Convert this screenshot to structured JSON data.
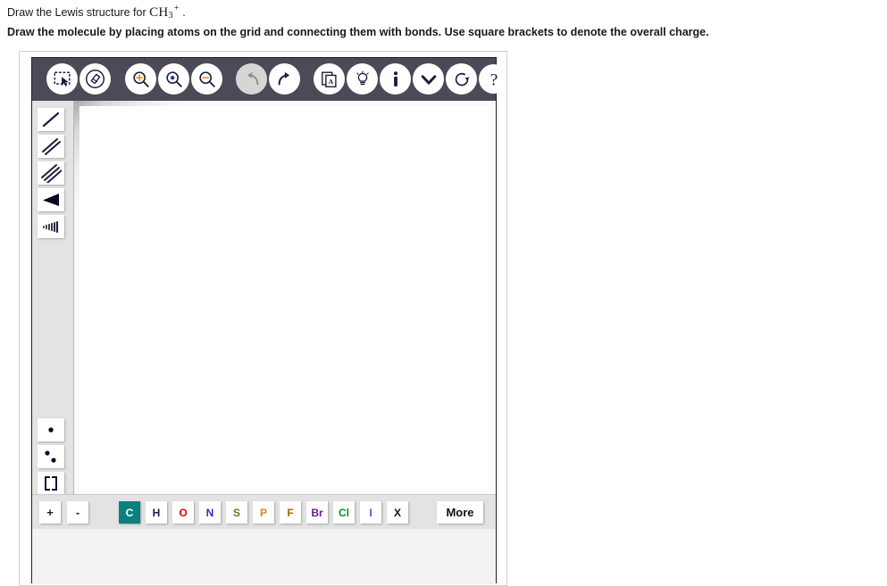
{
  "prompt": {
    "line1_prefix": "Draw the Lewis structure for ",
    "formula_element": "CH",
    "formula_sub": "3",
    "formula_sup": "+",
    "line1_suffix": " .",
    "line2": "Draw the molecule by placing atoms on the grid and connecting them with bonds. Use square brackets to denote the overall charge."
  },
  "toolbar": {
    "buttons": [
      {
        "name": "select-lasso-icon",
        "label": "Select",
        "disabled": false
      },
      {
        "name": "eraser-icon",
        "label": "Erase",
        "disabled": false
      },
      {
        "name": "zoom-in-icon",
        "label": "Zoom In",
        "disabled": false
      },
      {
        "name": "zoom-fit-icon",
        "label": "Zoom To Fit",
        "disabled": false
      },
      {
        "name": "zoom-out-icon",
        "label": "Zoom Out",
        "disabled": false
      },
      {
        "name": "undo-icon",
        "label": "Undo",
        "disabled": true
      },
      {
        "name": "redo-icon",
        "label": "Redo",
        "disabled": false
      },
      {
        "name": "copy-to-text-icon",
        "label": "Copy",
        "disabled": false
      },
      {
        "name": "lightbulb-icon",
        "label": "Hint",
        "disabled": false
      },
      {
        "name": "info-icon",
        "label": "Information",
        "disabled": false
      },
      {
        "name": "chevron-down-icon",
        "label": "More Options",
        "disabled": false
      },
      {
        "name": "reset-icon",
        "label": "Reset",
        "disabled": false
      },
      {
        "name": "help-icon",
        "label": "Help",
        "disabled": false
      }
    ]
  },
  "tools": {
    "bonds": [
      {
        "name": "single-bond-icon",
        "label": "Single Bond"
      },
      {
        "name": "double-bond-icon",
        "label": "Double Bond"
      },
      {
        "name": "triple-bond-icon",
        "label": "Triple Bond"
      },
      {
        "name": "wedge-bond-icon",
        "label": "Wedge Bond"
      },
      {
        "name": "hashed-bond-icon",
        "label": "Hashed Bond"
      }
    ],
    "electrons": [
      {
        "name": "single-electron-icon",
        "label": "Single Electron"
      },
      {
        "name": "lone-pair-icon",
        "label": "Lone Pair"
      },
      {
        "name": "brackets-icon",
        "label": "Brackets"
      }
    ]
  },
  "palette": {
    "charges": [
      {
        "label": "+",
        "name": "increase-charge-button"
      },
      {
        "label": "-",
        "name": "decrease-charge-button"
      }
    ],
    "elements": [
      {
        "symbol": "C",
        "color": "#ffffff",
        "selected": true
      },
      {
        "symbol": "H",
        "color": "#1a1a4e",
        "selected": false
      },
      {
        "symbol": "O",
        "color": "#e00000",
        "selected": false
      },
      {
        "symbol": "N",
        "color": "#4b1fc8",
        "selected": false
      },
      {
        "symbol": "S",
        "color": "#7a7016",
        "selected": false
      },
      {
        "symbol": "P",
        "color": "#d18a18",
        "selected": false
      },
      {
        "symbol": "F",
        "color": "#9a6a10",
        "selected": false
      },
      {
        "symbol": "Br",
        "color": "#6b1a8e",
        "selected": false
      },
      {
        "symbol": "Cl",
        "color": "#0f8a2a",
        "selected": false
      },
      {
        "symbol": "I",
        "color": "#7a3fc8",
        "selected": false
      },
      {
        "symbol": "X",
        "color": "#111111",
        "selected": false
      }
    ],
    "more_label": "More"
  },
  "colors": {
    "toolbar_bg": "#4a4a58",
    "strip_bg": "#e3e3e3",
    "canvas_bg": "#ffffff",
    "selected_element_bg": "#0b8080"
  }
}
